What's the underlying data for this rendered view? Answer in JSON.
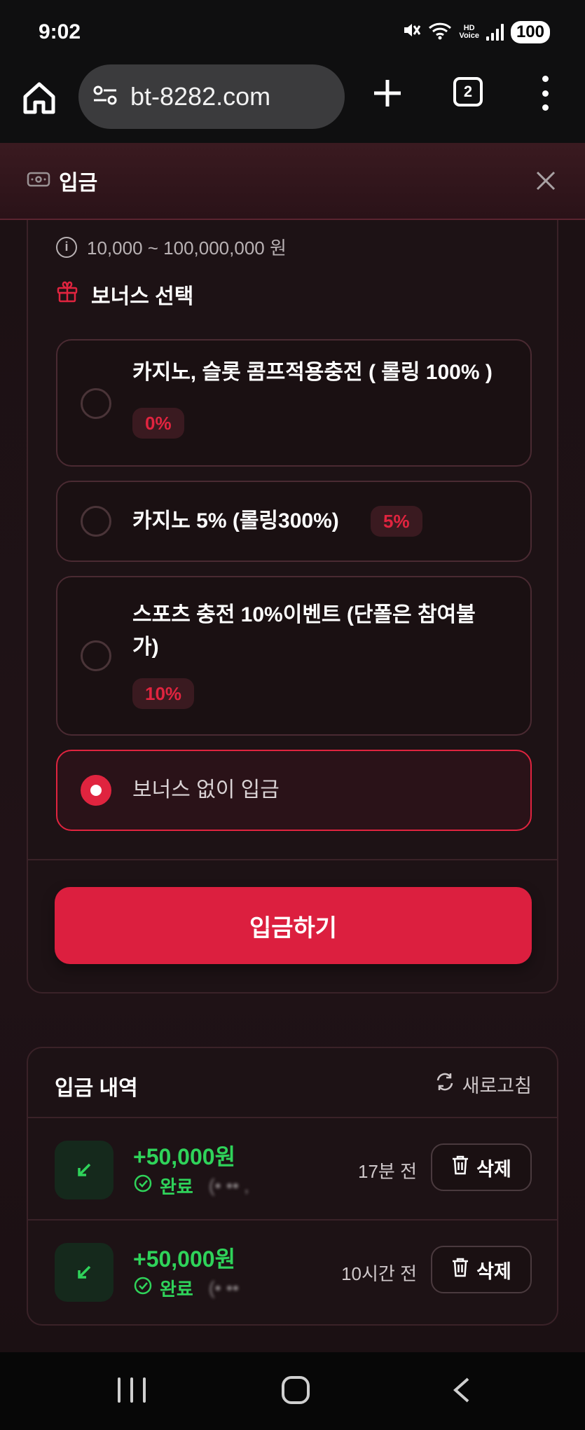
{
  "status_bar": {
    "time": "9:02",
    "hd_top": "HD",
    "hd_bottom": "Voice",
    "battery": "100"
  },
  "browser": {
    "url": "bt-8282.com",
    "tab_count": "2"
  },
  "modal": {
    "title": "입금"
  },
  "deposit": {
    "range_text": "10,000 ~ 100,000,000 원",
    "bonus_title": "보너스 선택",
    "options": [
      {
        "label": "카지노, 슬롯 콤프적용충전 ( 롤링 100% )",
        "badge": "0%",
        "selected": false
      },
      {
        "label": "카지노 5% (롤링300%)",
        "badge": "5%",
        "selected": false
      },
      {
        "label_line1": "스포츠 충전 10%이벤트 (단폴은 참여불",
        "label_line2": "가)",
        "badge": "10%",
        "selected": false
      },
      {
        "label": "보너스 없이 입금",
        "selected": true
      }
    ],
    "submit_label": "입금하기"
  },
  "history": {
    "title": "입금 내역",
    "refresh_label": "새로고침",
    "delete_label": "삭제",
    "rows": [
      {
        "amount": "+50,000원",
        "status": "완료",
        "masked": "(• •• ,",
        "time_ago": "17분 전"
      },
      {
        "amount": "+50,000원",
        "status": "완료",
        "masked": "(• ••",
        "time_ago": "10시간 전"
      }
    ]
  },
  "colors": {
    "accent": "#dc1f3f",
    "success": "#2fd35a",
    "background": "#1a0f12"
  }
}
